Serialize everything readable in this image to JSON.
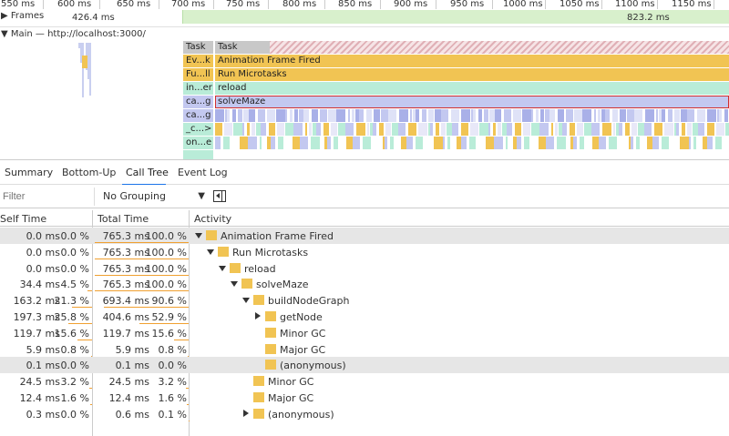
{
  "ruler": {
    "ticks": [
      "550 ms",
      "600 ms",
      "650 ms",
      "700 ms",
      "750 ms",
      "800 ms",
      "850 ms",
      "900 ms",
      "950 ms",
      "1000 ms",
      "1050 ms",
      "1100 ms",
      "1150 ms"
    ]
  },
  "frames": {
    "label": "▶ Frames",
    "duration_1": "426.4 ms",
    "duration_2": "823.2 ms"
  },
  "main": {
    "label": "▼ Main — http://localhost:3000/"
  },
  "flame": {
    "rows": [
      {
        "short": "Task",
        "label": "Task",
        "color": "gray"
      },
      {
        "short": "Ev...k",
        "label": "Animation Frame Fired",
        "color": "yellow"
      },
      {
        "short": "Fu...ll",
        "label": "Run Microtasks",
        "color": "yellow"
      },
      {
        "short": "in...er",
        "label": "reload",
        "color": "green"
      },
      {
        "short": "ca...g",
        "label": "solveMaze",
        "color": "blue"
      },
      {
        "short": "ca...g",
        "label": "",
        "color": "blue"
      },
      {
        "short": "_c...>",
        "label": "",
        "color": "green"
      },
      {
        "short": "on...e",
        "label": "",
        "color": "green"
      }
    ]
  },
  "tabs": [
    "Summary",
    "Bottom-Up",
    "Call Tree",
    "Event Log"
  ],
  "active_tab": "Call Tree",
  "toolbar": {
    "filter_placeholder": "Filter",
    "grouping": "No Grouping"
  },
  "columns": {
    "self": "Self Time",
    "total": "Total Time",
    "activity": "Activity"
  },
  "rows": [
    {
      "self_ms": "0.0 ms",
      "self_pct": "0.0 %",
      "total_ms": "765.3 ms",
      "total_pct": "100.0 %",
      "activity": "Animation Frame Fired",
      "depth": 0,
      "expander": "down",
      "self_frac": 0.0,
      "total_frac": 1.0,
      "selected": true
    },
    {
      "self_ms": "0.0 ms",
      "self_pct": "0.0 %",
      "total_ms": "765.3 ms",
      "total_pct": "100.0 %",
      "activity": "Run Microtasks",
      "depth": 1,
      "expander": "down",
      "self_frac": 0.0,
      "total_frac": 1.0,
      "selected": false
    },
    {
      "self_ms": "0.0 ms",
      "self_pct": "0.0 %",
      "total_ms": "765.3 ms",
      "total_pct": "100.0 %",
      "activity": "reload",
      "depth": 2,
      "expander": "down",
      "self_frac": 0.0,
      "total_frac": 1.0,
      "selected": false
    },
    {
      "self_ms": "34.4 ms",
      "self_pct": "4.5 %",
      "total_ms": "765.3 ms",
      "total_pct": "100.0 %",
      "activity": "solveMaze",
      "depth": 3,
      "expander": "down",
      "self_frac": 0.045,
      "total_frac": 1.0,
      "selected": false
    },
    {
      "self_ms": "163.2 ms",
      "self_pct": "21.3 %",
      "total_ms": "693.4 ms",
      "total_pct": "90.6 %",
      "activity": "buildNodeGraph",
      "depth": 4,
      "expander": "down",
      "self_frac": 0.213,
      "total_frac": 0.906,
      "selected": false
    },
    {
      "self_ms": "197.3 ms",
      "self_pct": "25.8 %",
      "total_ms": "404.6 ms",
      "total_pct": "52.9 %",
      "activity": "getNode",
      "depth": 5,
      "expander": "right",
      "self_frac": 0.258,
      "total_frac": 0.529,
      "selected": false
    },
    {
      "self_ms": "119.7 ms",
      "self_pct": "15.6 %",
      "total_ms": "119.7 ms",
      "total_pct": "15.6 %",
      "activity": "Minor GC",
      "depth": 5,
      "expander": "",
      "self_frac": 0.156,
      "total_frac": 0.156,
      "selected": false
    },
    {
      "self_ms": "5.9 ms",
      "self_pct": "0.8 %",
      "total_ms": "5.9 ms",
      "total_pct": "0.8 %",
      "activity": "Major GC",
      "depth": 5,
      "expander": "",
      "self_frac": 0.008,
      "total_frac": 0.008,
      "selected": false
    },
    {
      "self_ms": "0.1 ms",
      "self_pct": "0.0 %",
      "total_ms": "0.1 ms",
      "total_pct": "0.0 %",
      "activity": "(anonymous)",
      "depth": 5,
      "expander": "",
      "self_frac": 0.0,
      "total_frac": 0.0,
      "selected": true
    },
    {
      "self_ms": "24.5 ms",
      "self_pct": "3.2 %",
      "total_ms": "24.5 ms",
      "total_pct": "3.2 %",
      "activity": "Minor GC",
      "depth": 4,
      "expander": "",
      "self_frac": 0.032,
      "total_frac": 0.032,
      "selected": false
    },
    {
      "self_ms": "12.4 ms",
      "self_pct": "1.6 %",
      "total_ms": "12.4 ms",
      "total_pct": "1.6 %",
      "activity": "Major GC",
      "depth": 4,
      "expander": "",
      "self_frac": 0.016,
      "total_frac": 0.016,
      "selected": false
    },
    {
      "self_ms": "0.3 ms",
      "self_pct": "0.0 %",
      "total_ms": "0.6 ms",
      "total_pct": "0.1 %",
      "activity": "(anonymous)",
      "depth": 4,
      "expander": "right",
      "self_frac": 0.0,
      "total_frac": 0.001,
      "selected": false
    }
  ]
}
